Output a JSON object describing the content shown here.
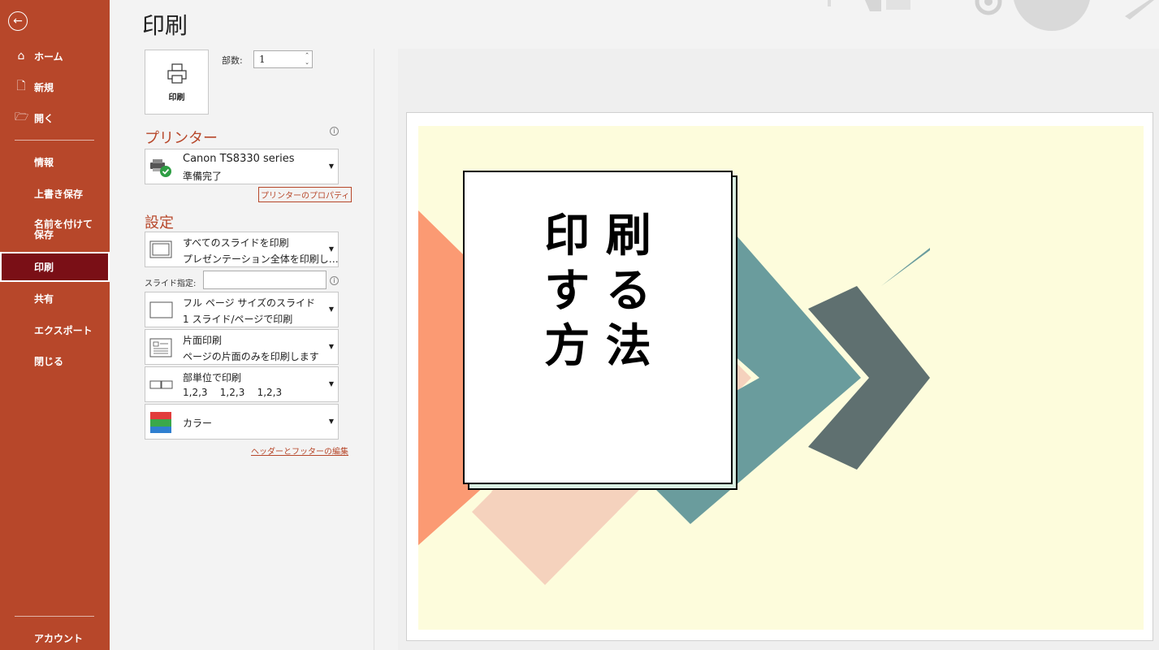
{
  "sidebar": {
    "back_icon": "back-arrow-icon",
    "items": [
      {
        "label": "ホーム",
        "icon": "home-icon"
      },
      {
        "label": "新規",
        "icon": "new-file-icon"
      },
      {
        "label": "開く",
        "icon": "open-folder-icon"
      },
      {
        "label": "情報"
      },
      {
        "label": "上書き保存"
      },
      {
        "label": "名前を付けて保存"
      },
      {
        "label": "印刷",
        "active": true
      },
      {
        "label": "共有"
      },
      {
        "label": "エクスポート"
      },
      {
        "label": "閉じる"
      }
    ],
    "account_label": "アカウント"
  },
  "main": {
    "title": "印刷",
    "print_button_label": "印刷",
    "copies_label": "部数:",
    "copies_value": "1",
    "printer_heading": "プリンター",
    "printer": {
      "name": "Canon TS8330 series",
      "status": "準備完了"
    },
    "printer_properties_link": "プリンターのプロパティ",
    "settings_heading": "設定",
    "settings": [
      {
        "line1": "すべてのスライドを印刷",
        "line2": "プレゼンテーション全体を印刷し…"
      },
      {
        "line1": "フル ページ サイズのスライド",
        "line2": "1 スライド/ページで印刷"
      },
      {
        "line1": "片面印刷",
        "line2": "ページの片面のみを印刷します"
      },
      {
        "line1": "部単位で印刷",
        "line2": "1,2,3    1,2,3    1,2,3"
      },
      {
        "line1": "カラー"
      }
    ],
    "slide_spec_label": "スライド指定:",
    "slide_spec_value": "",
    "header_footer_link": "ヘッダーとフッターの編集"
  },
  "preview": {
    "slide_text_lines": [
      "印 刷",
      "す る",
      "方 法"
    ],
    "colors": {
      "slide_bg": "#fdfcdc",
      "salmon": "#fb9a73",
      "peach": "#f5d2bd",
      "teal": "#6a9c9d",
      "slate": "#5f7070"
    }
  }
}
